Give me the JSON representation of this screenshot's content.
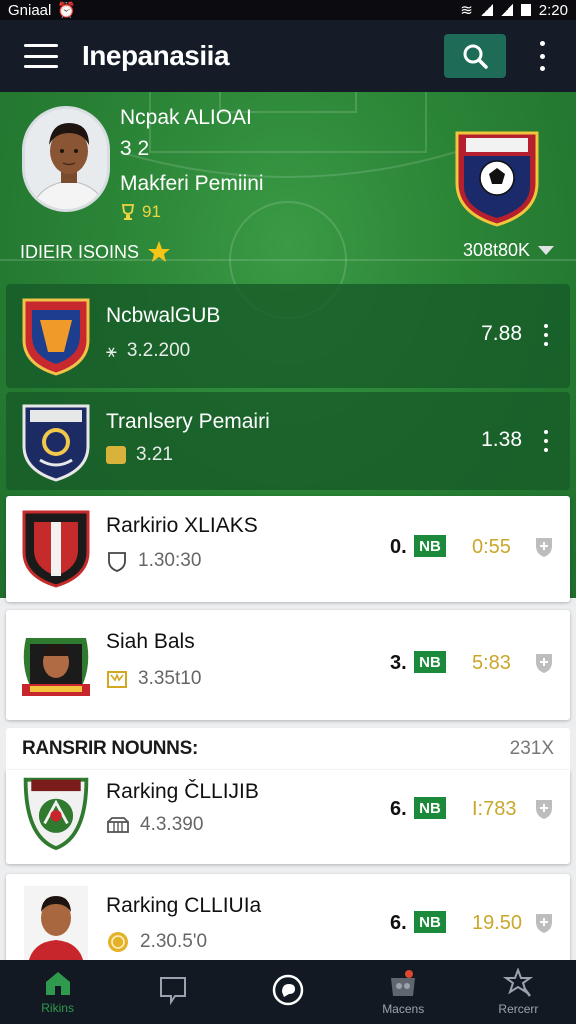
{
  "status_bar": {
    "carrier": "Gniaal",
    "time": "2:20"
  },
  "app_bar": {
    "title": "Inepanasiia"
  },
  "hero": {
    "player_name": "Ncpak ALIOAI",
    "player_score": "3 2",
    "club": "Makferi Pemiini",
    "rating": "91",
    "season_label": "IDIEIR ISOINS",
    "season_value": "308t80K"
  },
  "green_cards": [
    {
      "title": "NcbwalGUB",
      "sub": "3.2.200",
      "value": "7.88"
    },
    {
      "title": "Tranlsery Pemairi",
      "sub": "3.21",
      "value": "1.38"
    }
  ],
  "upper_rank_cards": [
    {
      "title": "Rarkirio XLIAKS",
      "sub": "1.30:30",
      "rank": "0.",
      "badge": "NB",
      "time": "0:55"
    },
    {
      "title": "Siah Bals",
      "sub": "3.35t10",
      "rank": "3.",
      "badge": "NB",
      "time": "5:83"
    }
  ],
  "section": {
    "title": "RANSRIR NOUNNS:",
    "count": "231X"
  },
  "lower_rank_cards": [
    {
      "title": "Rarking ČLLIJIB",
      "sub": "4.3.390",
      "rank": "6.",
      "badge": "NB",
      "time": "I:783"
    },
    {
      "title": "Rarking CLLIUIa",
      "sub": "2.30.5'0",
      "rank": "6.",
      "badge": "NB",
      "time": "19.50"
    }
  ],
  "bottom_nav": [
    {
      "label": "Rikins",
      "icon": "home-icon"
    },
    {
      "label": "",
      "icon": "chat-icon"
    },
    {
      "label": "",
      "icon": "message-bubble-icon"
    },
    {
      "label": "Macens",
      "icon": "match-icon"
    },
    {
      "label": "Rercerr",
      "icon": "referee-icon"
    }
  ],
  "colors": {
    "app_bar": "#161c27",
    "pitch": "#2a8436",
    "accent": "#1b8a3a",
    "gold": "#caa72a"
  }
}
